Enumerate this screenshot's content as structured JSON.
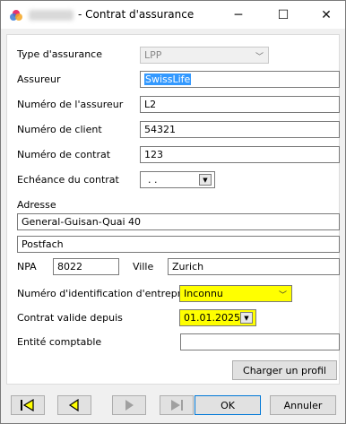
{
  "window": {
    "title": "- Contrat d'assurance",
    "minimize_glyph": "─",
    "maximize_glyph": "☐",
    "close_glyph": "✕"
  },
  "form": {
    "type_assurance": {
      "label": "Type d'assurance",
      "value": "LPP"
    },
    "assureur": {
      "label": "Assureur",
      "value": "SwissLife"
    },
    "numero_assureur": {
      "label": "Numéro de l'assureur",
      "value": "L2"
    },
    "numero_client": {
      "label": "Numéro de client",
      "value": "54321"
    },
    "numero_contrat": {
      "label": "Numéro de contrat",
      "value": "123"
    },
    "echeance": {
      "label": "Echéance du contrat",
      "value": ". ."
    },
    "adresse": {
      "label": "Adresse",
      "line1": "General-Guisan-Quai 40",
      "line2": "Postfach"
    },
    "npa": {
      "label": "NPA",
      "value": "8022"
    },
    "ville": {
      "label": "Ville",
      "value": "Zurich"
    },
    "ide": {
      "label": "Numéro d'identification d'entreprise",
      "value": "Inconnu"
    },
    "contrat_valide": {
      "label": "Contrat valide depuis",
      "value": "01.01.2025"
    },
    "entite": {
      "label": "Entité comptable",
      "value": ""
    }
  },
  "buttons": {
    "charger_profil": "Charger un profil",
    "ok": "OK",
    "annuler": "Annuler"
  },
  "colors": {
    "highlight": "#ffff00",
    "selection": "#3399ff",
    "nav_icon_active": "#ffff00",
    "nav_icon_disabled": "#a0a0a0"
  }
}
